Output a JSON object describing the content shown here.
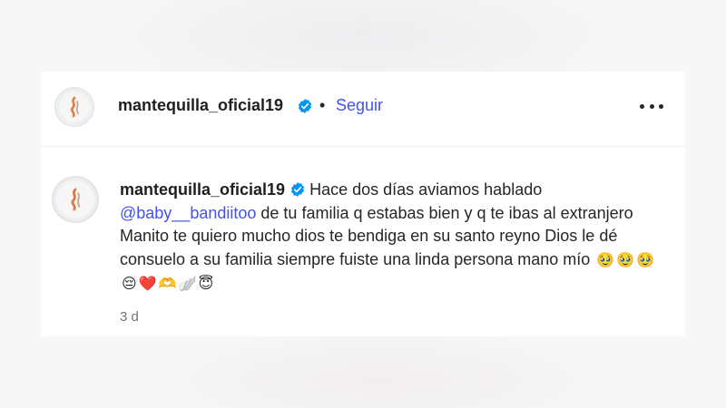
{
  "post": {
    "username": "mantequilla_oficial19",
    "follow_label": "Seguir",
    "separator": "•"
  },
  "comment": {
    "username": "mantequilla_oficial19",
    "text_before": "Hace dos días aviamos hablado",
    "mention": "@baby__bandiitoo",
    "text_after": "de tu familia q estabas bien y q te ibas al extranjero Manito te quiero mucho dios te bendiga en su santo reyno Dios le dé consuelo a su familia siempre fuiste una linda persona mano mío",
    "emojis": [
      "🥹",
      "🥹",
      "🥹",
      "😔",
      "❤️",
      "🫶",
      "🪽",
      "😇"
    ],
    "time": "3 d"
  },
  "colors": {
    "link": "#4150f7",
    "verified": "#0095f6",
    "muted": "#737373"
  },
  "icons": {
    "verified": "verified-badge-icon",
    "more": "more-options-icon",
    "avatar": "profile-avatar"
  }
}
